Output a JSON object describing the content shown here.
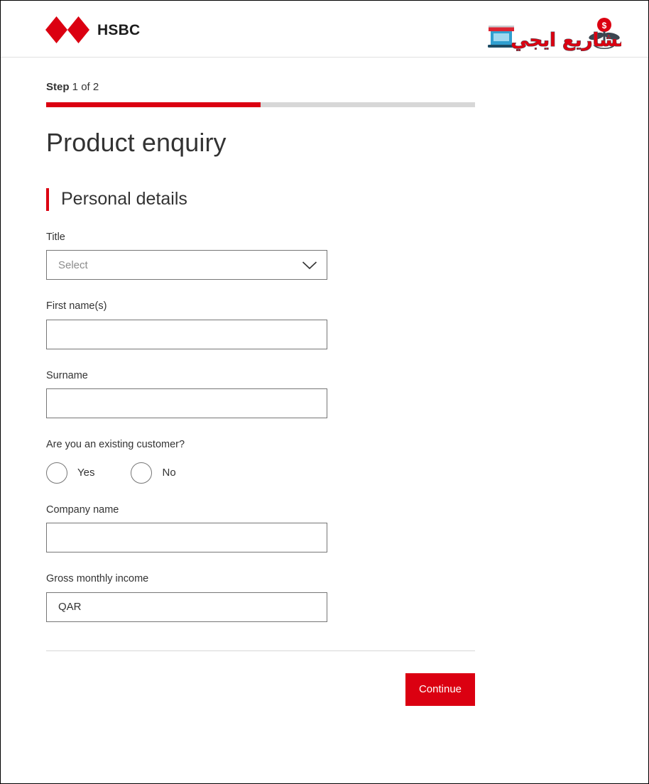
{
  "brand": {
    "name": "HSBC",
    "logo_icon": "hsbc-hexagon-icon",
    "primary_color": "#db0011"
  },
  "watermark": {
    "text": "مشاريع ايجي",
    "shop_icon": "storefront-icon",
    "money_plant_icon": "money-plant-icon"
  },
  "progress": {
    "step_word": "Step",
    "step_text": " 1 of 2",
    "current": 1,
    "total": 2,
    "fill_color": "#db0011",
    "track_color": "#d7d7d7"
  },
  "page_title": "Product enquiry",
  "section": {
    "title": "Personal details",
    "accent_color": "#db0011"
  },
  "fields": {
    "title": {
      "label": "Title",
      "placeholder": "Select",
      "value": "",
      "chevron_icon": "chevron-down-icon"
    },
    "first_name": {
      "label": "First name(s)",
      "placeholder": "",
      "value": ""
    },
    "surname": {
      "label": "Surname",
      "placeholder": "",
      "value": ""
    },
    "existing_customer": {
      "label": "Are you an existing customer?",
      "options": [
        {
          "label": "Yes",
          "selected": false
        },
        {
          "label": "No",
          "selected": false
        }
      ]
    },
    "company_name": {
      "label": "Company name",
      "placeholder": "",
      "value": ""
    },
    "gross_monthly_income": {
      "label": "Gross monthly income",
      "placeholder": "",
      "value": "QAR"
    }
  },
  "actions": {
    "continue_label": "Continue"
  }
}
